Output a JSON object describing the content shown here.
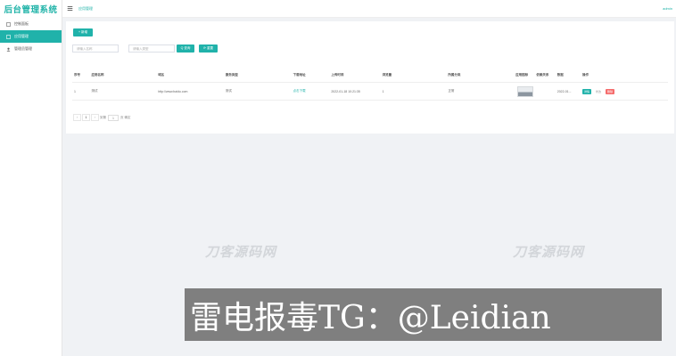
{
  "app": {
    "brand": "后台管理系统",
    "user": "admin",
    "active_tab": "应用管理"
  },
  "sidebar": {
    "items": [
      {
        "label": "控制面板",
        "icon": "dashboard-icon",
        "active": false
      },
      {
        "label": "应用管理",
        "icon": "app-icon",
        "active": true
      },
      {
        "label": "管理员管理",
        "icon": "user-icon",
        "active": false
      }
    ]
  },
  "toolbar": {
    "add_label": "+ 新增",
    "search_label": "Q 查询",
    "reset_label": "⟳ 重置"
  },
  "filters": {
    "name_placeholder": "请输入名称",
    "type_placeholder": "请输入类型"
  },
  "table": {
    "columns": [
      "序号",
      "应用名称",
      "域名",
      "服务类型",
      "下载地址",
      "上传时间",
      "浏览量",
      "所属分类",
      "应用图标",
      "依赖关系",
      "数据",
      "操作"
    ],
    "rows": [
      {
        "index": "1",
        "name": "测试",
        "domain": "http://www.baidu.com",
        "service": "测试",
        "download": "点击下载",
        "upload_time": "2022-01-18 10:21:35",
        "views": "1",
        "category": "正常",
        "extra": "",
        "data": "2022-01...",
        "actions": [
          "详情",
          "修改",
          "删除"
        ]
      }
    ]
  },
  "pagination": {
    "prev": "‹",
    "current": "1",
    "next": "›",
    "goto_label": "到第",
    "goto_value": "1",
    "unit": "页 确定"
  },
  "watermark": {
    "text": "刀客源码网"
  },
  "overlay": {
    "text": "雷电报毒TG：@Leidian"
  }
}
